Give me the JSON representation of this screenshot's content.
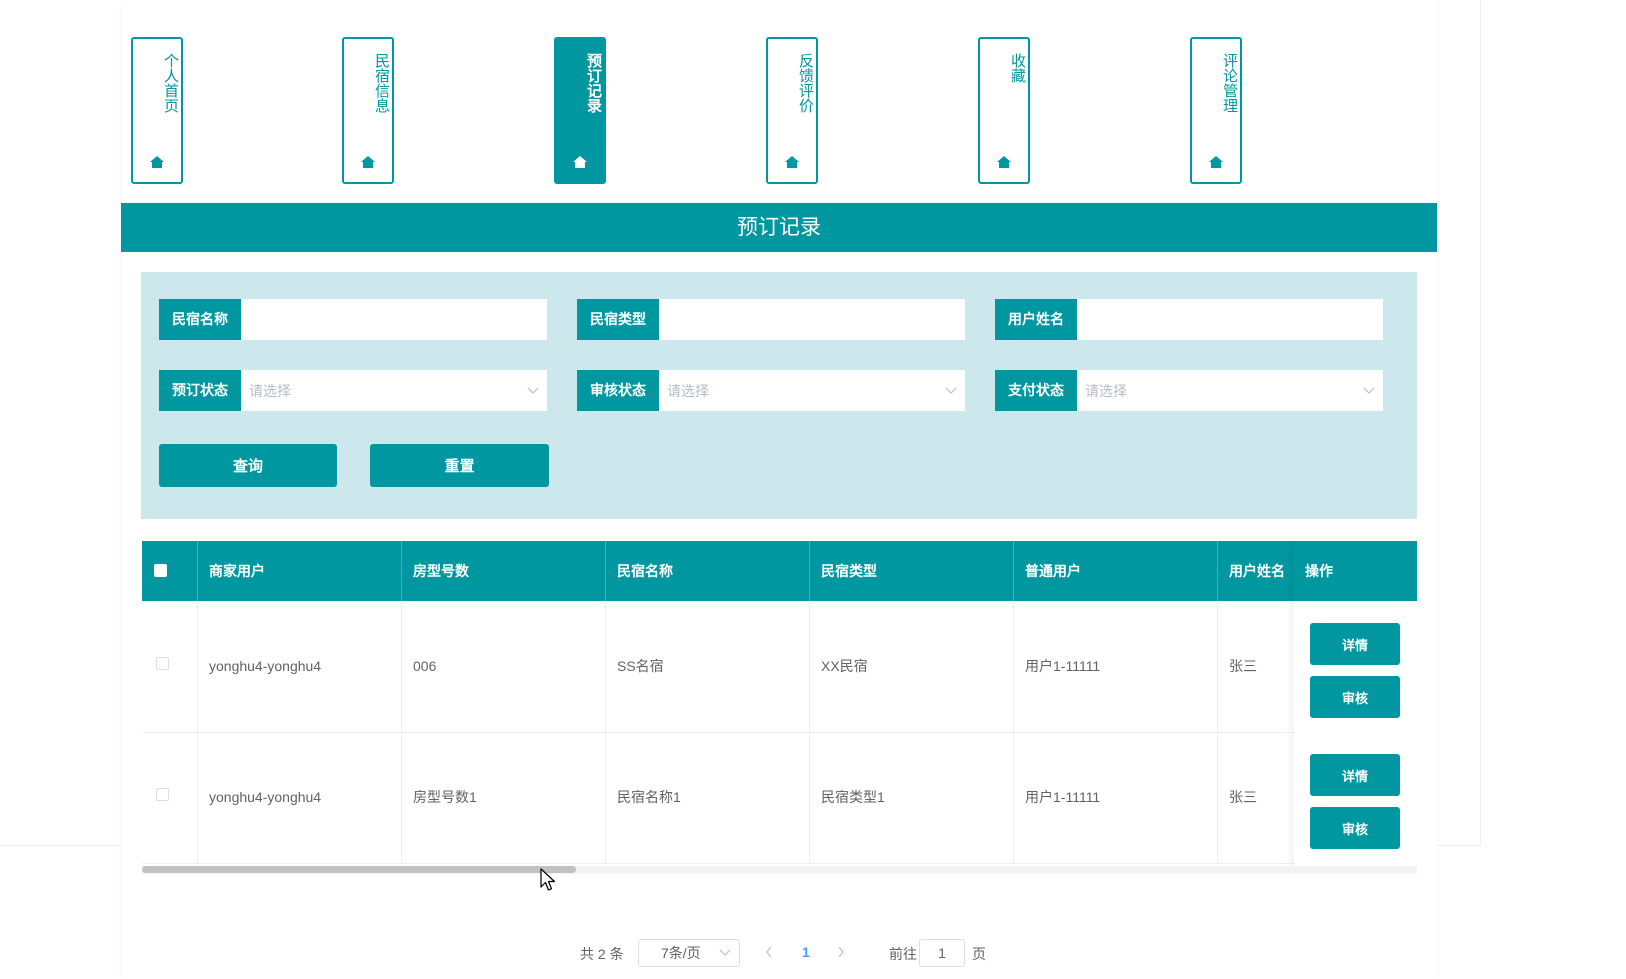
{
  "colors": {
    "primary": "#0097a0",
    "search_bg": "#cde8ec",
    "link_blue": "#409eff"
  },
  "nav": {
    "items": [
      {
        "label": "个人首页",
        "icon": "home-icon",
        "active": false
      },
      {
        "label": "民宿信息",
        "icon": "home-icon",
        "active": false
      },
      {
        "label": "预订记录",
        "icon": "home-icon",
        "active": true
      },
      {
        "label": "反馈评价",
        "icon": "home-icon",
        "active": false
      },
      {
        "label": "收藏",
        "icon": "home-icon",
        "active": false
      },
      {
        "label": "评论管理",
        "icon": "home-icon",
        "active": false
      }
    ]
  },
  "page_title": "预订记录",
  "search": {
    "fields": {
      "homestay_name": {
        "label": "民宿名称",
        "value": ""
      },
      "homestay_type": {
        "label": "民宿类型",
        "value": ""
      },
      "user_name": {
        "label": "用户姓名",
        "value": ""
      },
      "booking_status": {
        "label": "预订状态",
        "placeholder": "请选择"
      },
      "review_status": {
        "label": "审核状态",
        "placeholder": "请选择"
      },
      "payment_status": {
        "label": "支付状态",
        "placeholder": "请选择"
      }
    },
    "query_label": "查询",
    "reset_label": "重置"
  },
  "table": {
    "columns": [
      "商家用户",
      "房型号数",
      "民宿名称",
      "民宿类型",
      "普通用户",
      "用户姓名",
      "操作"
    ],
    "rows": [
      {
        "merchant": "yonghu4-yonghu4",
        "room_no": "006",
        "homestay_name": "SS名宿",
        "homestay_type": "XX民宿",
        "user": "用户1-11111",
        "user_name": "张三"
      },
      {
        "merchant": "yonghu4-yonghu4",
        "room_no": "房型号数1",
        "homestay_name": "民宿名称1",
        "homestay_type": "民宿类型1",
        "user": "用户1-11111",
        "user_name": "张三"
      }
    ],
    "detail_label": "详情",
    "review_label": "审核"
  },
  "pagination": {
    "total": "共 2 条",
    "page_size": "7条/页",
    "current_page": "1",
    "goto_label": "前往",
    "goto_value": "1",
    "page_suffix": "页"
  }
}
